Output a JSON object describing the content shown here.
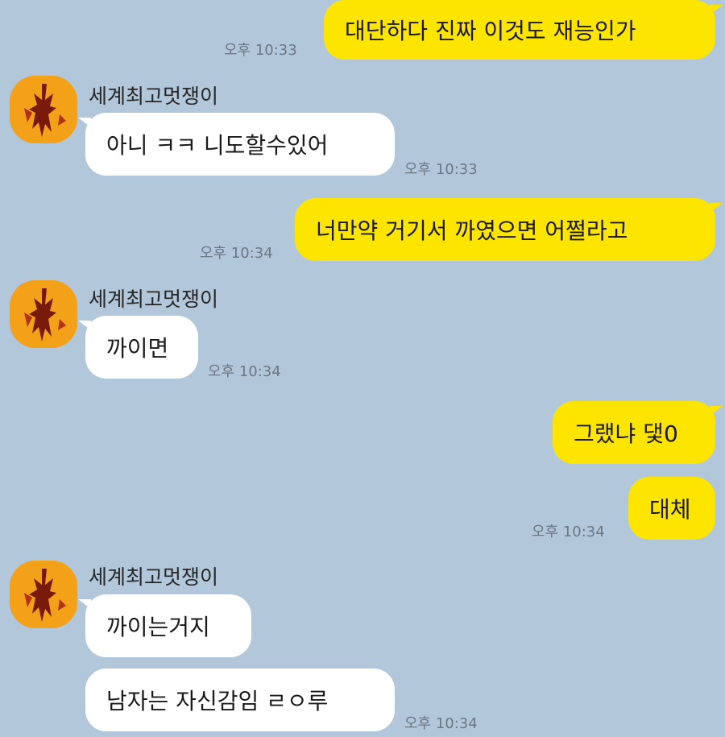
{
  "contact": {
    "name": "세계최고멋쟁이"
  },
  "messages": [
    {
      "from": "me",
      "text": "대단하다 진짜 이것도 재능인가",
      "time": "오후 10:33"
    },
    {
      "from": "other",
      "text": "아니 ㅋㅋ 니도할수있어",
      "time": "오후 10:33"
    },
    {
      "from": "me",
      "text": "너만약 거기서 까였으면 어쩔라고",
      "time": "오후 10:34"
    },
    {
      "from": "other",
      "text": "까이면",
      "time": "오후 10:34"
    },
    {
      "from": "me",
      "text": "그랬냐 댗0",
      "time": ""
    },
    {
      "from": "me",
      "text": "대체",
      "time": "오후 10:34"
    },
    {
      "from": "other",
      "text": "까이는거지",
      "time": ""
    },
    {
      "from": "other",
      "text": "남자는 자신감임 ㄹㅇ루",
      "time": "오후 10:34"
    }
  ],
  "colors": {
    "background": "#b2c7da",
    "outgoing": "#fee500",
    "incoming": "#ffffff"
  },
  "icons": {
    "avatar": "profile-avatar-icon"
  }
}
